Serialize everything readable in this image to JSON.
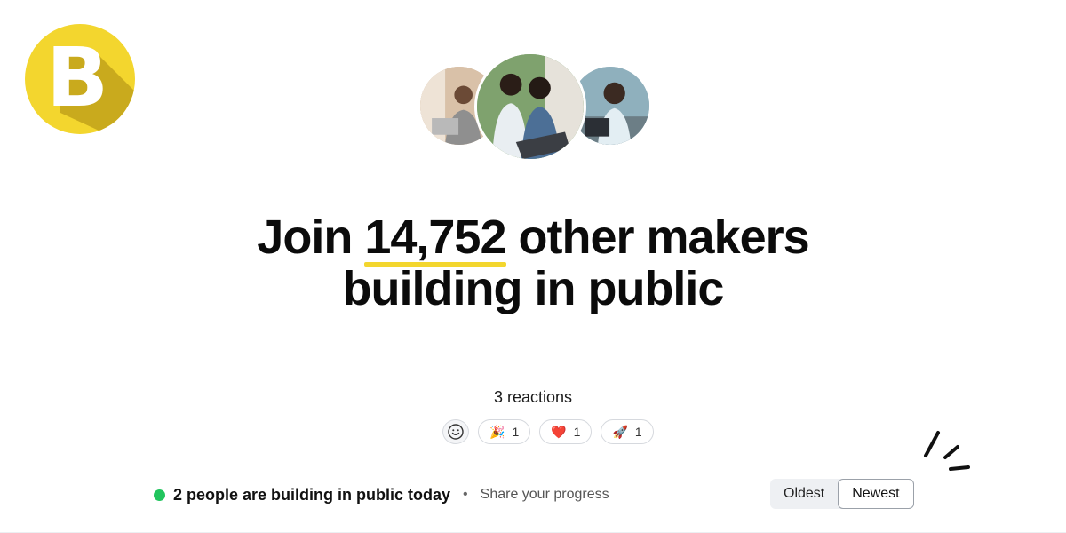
{
  "brand": {
    "logo_letter": "B",
    "accent": "#f3d62e"
  },
  "hero": {
    "avatars": [
      "avatar-woman-laptop",
      "avatar-two-men-laptop",
      "avatar-woman-curly-laptop"
    ],
    "headline_prefix": "Join",
    "headline_count": "14,752",
    "headline_suffix": "other makers",
    "headline_line2": "building in public"
  },
  "reactions": {
    "title": "3 reactions",
    "items": [
      {
        "emoji": "🎉",
        "count": "1"
      },
      {
        "emoji": "❤️",
        "count": "1"
      },
      {
        "emoji": "🚀",
        "count": "1"
      }
    ]
  },
  "feed": {
    "status_text": "2 people are building in public today",
    "separator": "•",
    "share_link": "Share your progress",
    "status_color": "#21c45d",
    "sort": {
      "options": [
        "Oldest",
        "Newest"
      ],
      "selected": "Newest"
    }
  }
}
